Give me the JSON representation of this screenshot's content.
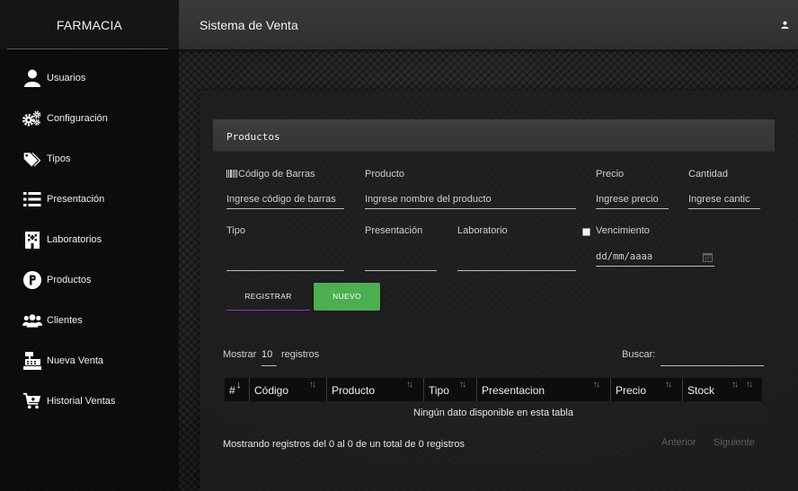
{
  "brand": "FARMACIA",
  "header": {
    "title": "Sistema de Venta",
    "user_icon": "user-icon"
  },
  "sidebar": {
    "items": [
      {
        "label": "Usuarios",
        "icon": "user-icon"
      },
      {
        "label": "Configuración",
        "icon": "gears-icon"
      },
      {
        "label": "Tipos",
        "icon": "tags-icon"
      },
      {
        "label": "Presentación",
        "icon": "list-icon"
      },
      {
        "label": "Laboratorios",
        "icon": "building-icon"
      },
      {
        "label": "Productos",
        "icon": "product-p-icon"
      },
      {
        "label": "Clientes",
        "icon": "users-icon"
      },
      {
        "label": "Nueva Venta",
        "icon": "cash-register-icon"
      },
      {
        "label": "Historial Ventas",
        "icon": "cart-plus-icon"
      }
    ]
  },
  "card": {
    "title": "Productos"
  },
  "form": {
    "barcode": {
      "label": "Código de Barras",
      "placeholder": "Ingrese código de barras",
      "icon": "barcode-icon"
    },
    "product": {
      "label": "Producto",
      "placeholder": "Ingrese nombre del producto"
    },
    "price": {
      "label": "Precio",
      "placeholder": "Ingrese precio"
    },
    "quantity": {
      "label": "Cantidad",
      "placeholder": "Ingrese cantic"
    },
    "type": {
      "label": "Tipo",
      "value": ""
    },
    "presentation": {
      "label": "Presentación",
      "value": ""
    },
    "laboratory": {
      "label": "Laboratorio",
      "value": ""
    },
    "expiry": {
      "label": "Vencimiento",
      "checked": false,
      "date_placeholder": "dd/mm/aaaa",
      "icon": "calendar-icon"
    },
    "register_button": "REGISTRAR",
    "new_button": "NUEVO",
    "colors": {
      "new_button": "#4caf50",
      "register_underline": "#7a3fb0"
    }
  },
  "table": {
    "show_prefix": "Mostrar",
    "show_value": "10",
    "show_suffix": "registros",
    "search_label": "Buscar:",
    "search_value": "",
    "columns": [
      "#",
      "Código",
      "Producto",
      "Tipo",
      "Presentacion",
      "Precio",
      "Stock"
    ],
    "empty_message": "Ningún dato disponible en esta tabla",
    "info": "Mostrando registros del 0 al 0 de un total de 0 registros",
    "prev": "Anterior",
    "next": "Siguiente"
  }
}
